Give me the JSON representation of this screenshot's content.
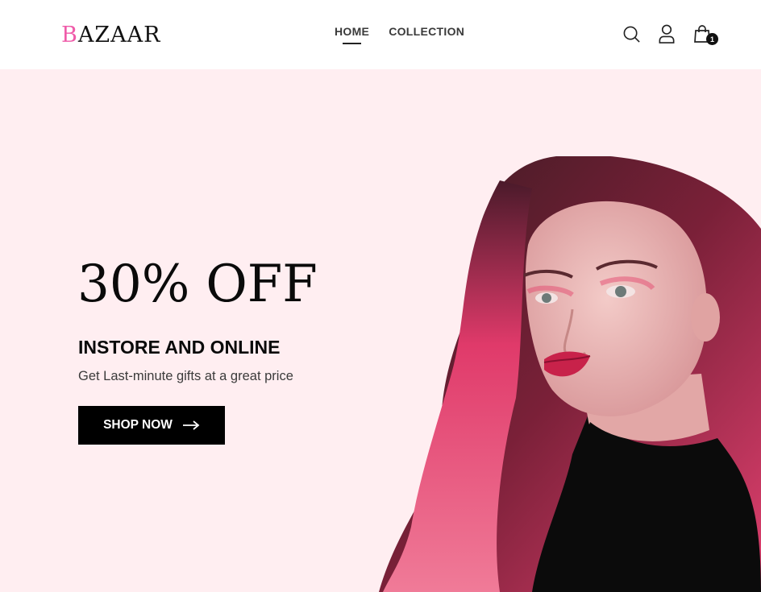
{
  "brand": {
    "logo_first": "B",
    "logo_rest": "AZAAR"
  },
  "nav": {
    "items": [
      "HOME",
      "COLLECTION"
    ],
    "active": "HOME"
  },
  "header_icons": {
    "search": "search-icon",
    "account": "user-icon",
    "cart": "shopping-bag-icon",
    "cart_count": "1"
  },
  "hero": {
    "title": "30% OFF",
    "subtitle": "INSTORE AND ONLINE",
    "description": "Get Last-minute gifts at a great price",
    "cta_label": "SHOP NOW",
    "cta_icon": "arrow-right-icon",
    "image": "model-portrait"
  },
  "colors": {
    "accent": "#ef5ba9",
    "hero_bg": "#ffeef1",
    "button_bg": "#000000",
    "hair_pink": "#e0406f"
  }
}
